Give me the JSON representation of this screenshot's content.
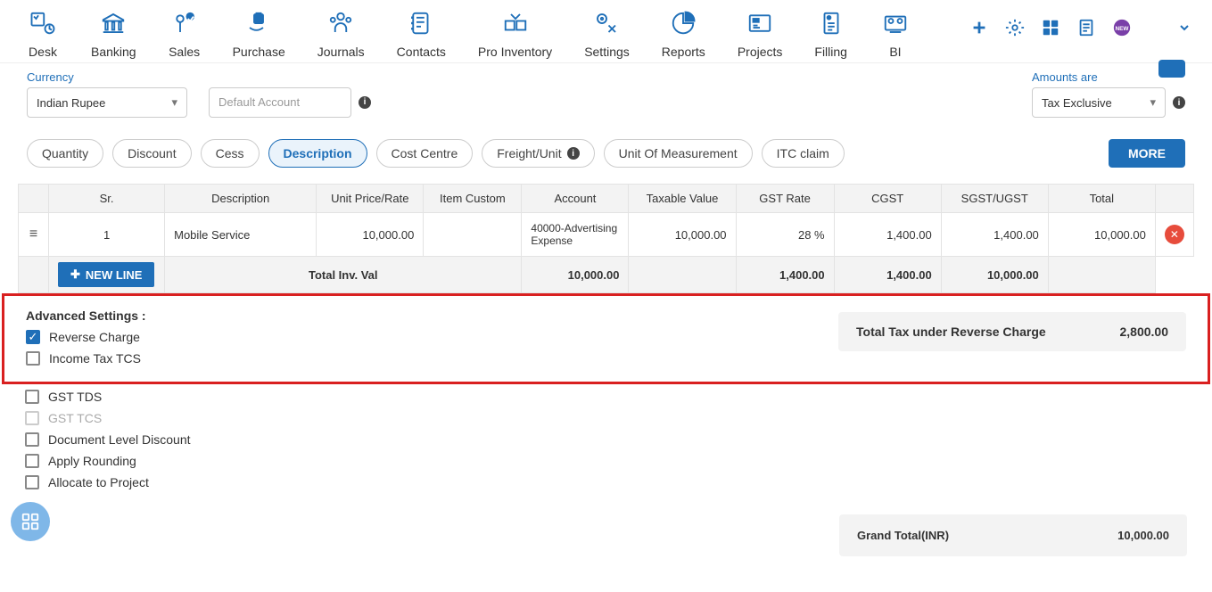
{
  "topnav": [
    {
      "label": "Desk"
    },
    {
      "label": "Banking"
    },
    {
      "label": "Sales"
    },
    {
      "label": "Purchase"
    },
    {
      "label": "Journals"
    },
    {
      "label": "Contacts"
    },
    {
      "label": "Pro Inventory"
    },
    {
      "label": "Settings"
    },
    {
      "label": "Reports"
    },
    {
      "label": "Projects"
    },
    {
      "label": "Filling"
    },
    {
      "label": "BI"
    }
  ],
  "currency": {
    "label": "Currency",
    "value": "Indian Rupee"
  },
  "default_account_placeholder": "Default Account",
  "amounts": {
    "label": "Amounts are",
    "value": "Tax Exclusive"
  },
  "pills": {
    "quantity": "Quantity",
    "discount": "Discount",
    "cess": "Cess",
    "description": "Description",
    "cost_centre": "Cost Centre",
    "freight_unit": "Freight/Unit",
    "uom": "Unit Of Measurement",
    "itc": "ITC claim",
    "more": "MORE"
  },
  "table": {
    "headers": {
      "sr": "Sr.",
      "desc": "Description",
      "unit_price": "Unit Price/Rate",
      "item_custom": "Item Custom",
      "account": "Account",
      "taxable": "Taxable Value",
      "gst_rate": "GST Rate",
      "cgst": "CGST",
      "sgst": "SGST/UGST",
      "total": "Total"
    },
    "row": {
      "sr": "1",
      "desc": "Mobile Service",
      "unit_price": "10,000.00",
      "item_custom": "",
      "account": "40000-Advertising Expense",
      "taxable": "10,000.00",
      "gst_rate": "28 %",
      "cgst": "1,400.00",
      "sgst": "1,400.00",
      "total": "10,000.00"
    },
    "totals": {
      "label": "Total Inv. Val",
      "taxable": "10,000.00",
      "cgst": "1,400.00",
      "sgst": "1,400.00",
      "total": "10,000.00"
    },
    "new_line": "NEW LINE"
  },
  "advanced": {
    "title": "Advanced Settings :",
    "reverse_charge": "Reverse Charge",
    "income_tax_tcs": "Income Tax TCS",
    "gst_tds": "GST TDS",
    "gst_tcs": "GST TCS",
    "doc_discount": "Document Level Discount",
    "apply_rounding": "Apply Rounding",
    "allocate_project": "Allocate to Project"
  },
  "reverse_tax": {
    "label": "Total Tax under Reverse Charge",
    "value": "2,800.00"
  },
  "grand_total": {
    "label": "Grand Total(INR)",
    "value": "10,000.00"
  }
}
